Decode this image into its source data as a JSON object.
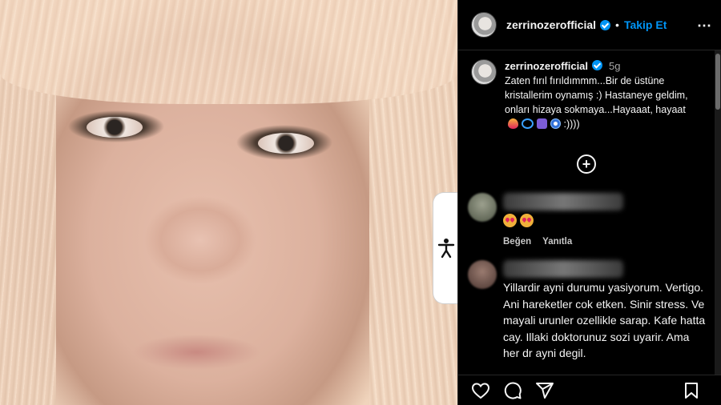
{
  "post": {
    "username": "zerrinozerofficial",
    "dot": "•",
    "follow_label": "Takip Et",
    "more_icon": "⋯",
    "caption": {
      "username": "zerrinozerofficial",
      "time": "5g",
      "text": "Zaten fırıl fırıldımmm...Bir de üstüne kristallerim oynamış :) Hastaneye geldim, onları hizaya sokmaya...Hayaaat, hayaat",
      "text_tail": ":))))",
      "emoji_icons": [
        "heart-on-fire-icon",
        "infinity-icon",
        "peace-icon",
        "nazar-icon"
      ]
    }
  },
  "comments": [
    {
      "text": "",
      "emoji_icons": [
        "heart-eyes-icon",
        "heart-eyes-icon"
      ],
      "like_label": "Beğen",
      "reply_label": "Yanıtla"
    },
    {
      "text": "Yillardir ayni durumu yasiyorum. Vertigo. Ani hareketler cok etken. Sinir stress. Ve mayali urunler ozellikle sarap. Kafe hatta cay. Illaki doktorunuz sozi uyarir. Ama her dr ayni degil."
    }
  ],
  "actions": [
    "heart-icon",
    "comment-icon",
    "share-icon",
    "bookmark-icon"
  ],
  "colors": {
    "accent": "#0095f6",
    "background": "#000000",
    "text": "#f5f5f5"
  }
}
